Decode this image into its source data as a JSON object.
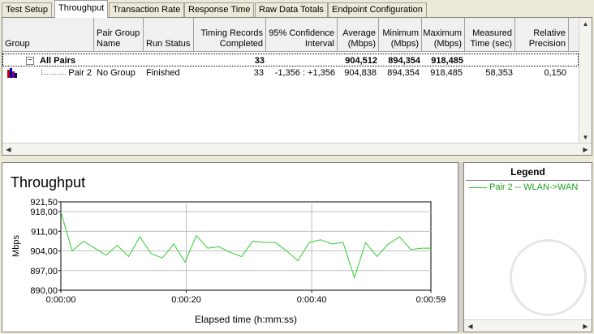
{
  "tabs": [
    {
      "label": "Test Setup",
      "active": false
    },
    {
      "label": "Throughput",
      "active": true
    },
    {
      "label": "Transaction Rate",
      "active": false
    },
    {
      "label": "Response Time",
      "active": false
    },
    {
      "label": "Raw Data Totals",
      "active": false
    },
    {
      "label": "Endpoint Configuration",
      "active": false
    }
  ],
  "table": {
    "headers": {
      "group": "Group",
      "pair_group_name": "Pair Group Name",
      "run_status": "Run Status",
      "timing_records": "Timing Records Completed",
      "confidence": "95% Confidence Interval",
      "average": "Average (Mbps)",
      "minimum": "Minimum (Mbps)",
      "maximum": "Maximum (Mbps)",
      "measured_time": "Measured Time (sec)",
      "relative_precision": "Relative Precision"
    },
    "group_row": {
      "expander": "−",
      "group": "All Pairs",
      "timing_records": "33",
      "average": "904,512",
      "minimum": "894,354",
      "maximum": "918,485"
    },
    "pair_row": {
      "group": "Pair 2",
      "pair_group_name": "No Group",
      "run_status": "Finished",
      "timing_records": "33",
      "confidence": "-1,356 : +1,356",
      "average": "904,838",
      "minimum": "894,354",
      "maximum": "918,485",
      "measured_time": "58,353",
      "relative_precision": "0,150"
    }
  },
  "chart_data": {
    "type": "line",
    "title": "Throughput",
    "xlabel": "Elapsed time (h:mm:ss)",
    "ylabel": "Mbps",
    "ylim": [
      890.0,
      921.5
    ],
    "xlim": [
      0,
      59
    ],
    "yticks": [
      "921,50",
      "918,00",
      "911,00",
      "904,00",
      "897,00",
      "890,00"
    ],
    "ytick_values": [
      921.5,
      918.0,
      911.0,
      904.0,
      897.0,
      890.0
    ],
    "xticks": [
      "0:00:00",
      "0:00:20",
      "0:00:40",
      "0:00:59"
    ],
    "xtick_values": [
      0,
      20,
      40,
      59
    ],
    "grid": true,
    "line_color": "#33cc33",
    "series": [
      {
        "name": "Pair 2 -- WLAN->WAN",
        "x": [
          0,
          1.8,
          3.6,
          5.4,
          7.2,
          9.0,
          10.8,
          12.6,
          14.4,
          16.2,
          18.0,
          19.8,
          21.6,
          23.4,
          25.2,
          27.0,
          28.8,
          30.6,
          32.4,
          34.2,
          36.0,
          37.8,
          39.6,
          41.4,
          43.2,
          45.0,
          46.8,
          48.6,
          50.4,
          52.2,
          54.0,
          55.8,
          57.6,
          59.0
        ],
        "y": [
          918.0,
          904.0,
          907.5,
          905.0,
          902.5,
          906.0,
          902.0,
          909.0,
          903.0,
          901.5,
          906.5,
          900.0,
          909.5,
          905.0,
          905.5,
          903.5,
          902.0,
          907.5,
          907.0,
          907.0,
          904.0,
          900.5,
          907.0,
          908.0,
          906.5,
          907.0,
          894.5,
          907.0,
          902.0,
          906.5,
          909.0,
          904.5,
          905.0,
          905.0
        ]
      }
    ]
  },
  "legend": {
    "title": "Legend",
    "entries": [
      {
        "label": "Pair 2 -- WLAN->WAN",
        "color": "#33cc33"
      }
    ]
  }
}
